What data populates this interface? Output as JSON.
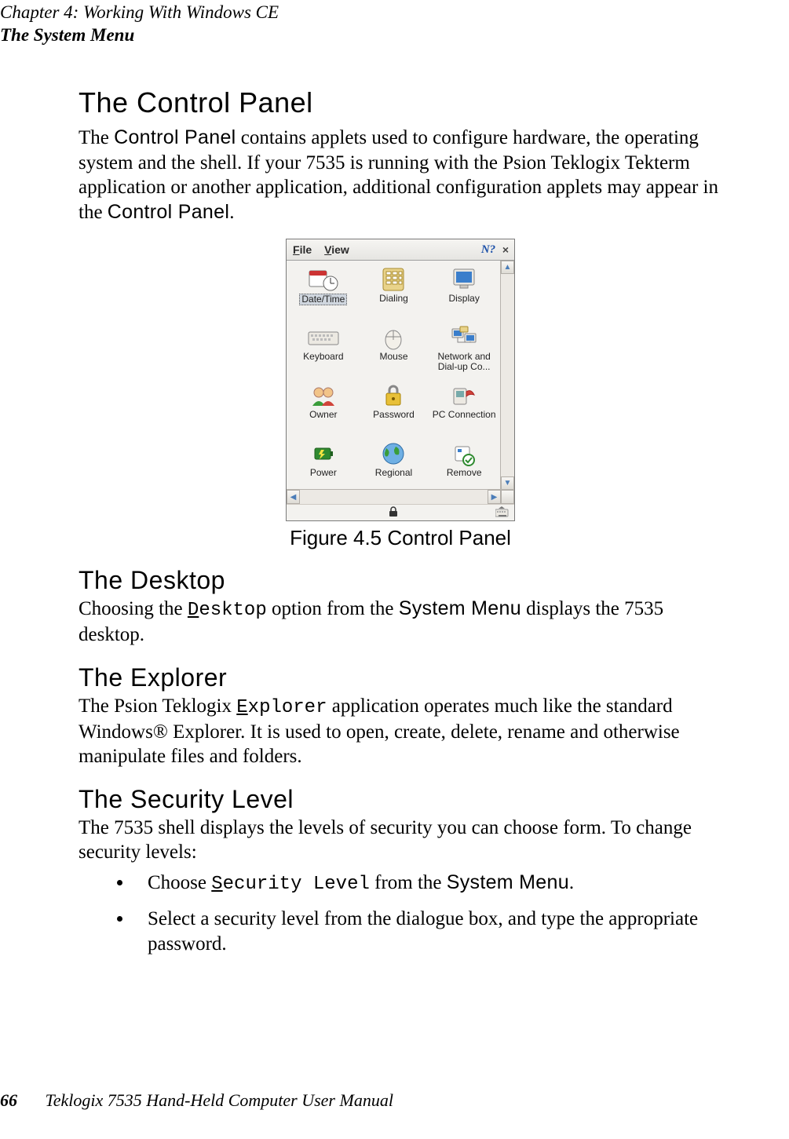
{
  "header": {
    "line1": "Chapter  4:  Working With Windows CE",
    "line2": "The System Menu"
  },
  "sections": {
    "control_panel_heading": "The Control Panel",
    "control_panel_para_a": "The ",
    "control_panel_term1": "Control Panel",
    "control_panel_para_b": " contains applets used to configure hardware, the operating system and the shell. If your 7535 is running with the Psion Teklogix Tekterm application or another application, additional configuration applets may appear in the ",
    "control_panel_term2": "Control Panel",
    "control_panel_para_c": ".",
    "figure_caption": "Figure 4.5 Control Panel",
    "desktop_heading": "The Desktop",
    "desktop_para_a": "Choosing the ",
    "desktop_mono_u": "D",
    "desktop_mono_rest": "esktop",
    "desktop_para_b": " option from the ",
    "desktop_ui1": "System Menu",
    "desktop_para_c": " displays the 7535 desktop.",
    "explorer_heading": "The Explorer",
    "explorer_para_a": "The Psion Teklogix ",
    "explorer_mono_u": "E",
    "explorer_mono_rest": "xplorer",
    "explorer_para_b": " application operates much like the standard Windows® Explorer. It is used to open, create, delete, rename and otherwise manipulate files and folders.",
    "security_heading": "The Security Level",
    "security_para": "The 7535 shell displays the levels of security you can choose form. To change security levels:",
    "bullet1_a": "Choose ",
    "bullet1_mono_u": "S",
    "bullet1_mono_rest": "ecurity Level",
    "bullet1_b": " from the ",
    "bullet1_ui": "System Menu",
    "bullet1_c": ".",
    "bullet2": "Select a security level from the dialogue box, and type the appropriate password."
  },
  "control_panel_window": {
    "menu_file_u": "F",
    "menu_file_rest": "ile",
    "menu_view_u": "V",
    "menu_view_rest": "iew",
    "help": "?",
    "close": "×",
    "items": [
      {
        "label": "Date/Time",
        "selected": true
      },
      {
        "label": "Dialing"
      },
      {
        "label": "Display"
      },
      {
        "label": "Keyboard"
      },
      {
        "label": "Mouse"
      },
      {
        "label": "Network and Dial-up Co..."
      },
      {
        "label": "Owner"
      },
      {
        "label": "Password"
      },
      {
        "label": "PC Connection"
      },
      {
        "label": "Power"
      },
      {
        "label": "Regional"
      },
      {
        "label": "Remove"
      }
    ]
  },
  "footer": {
    "page": "66",
    "title": "Teklogix 7535 Hand-Held Computer User Manual"
  }
}
